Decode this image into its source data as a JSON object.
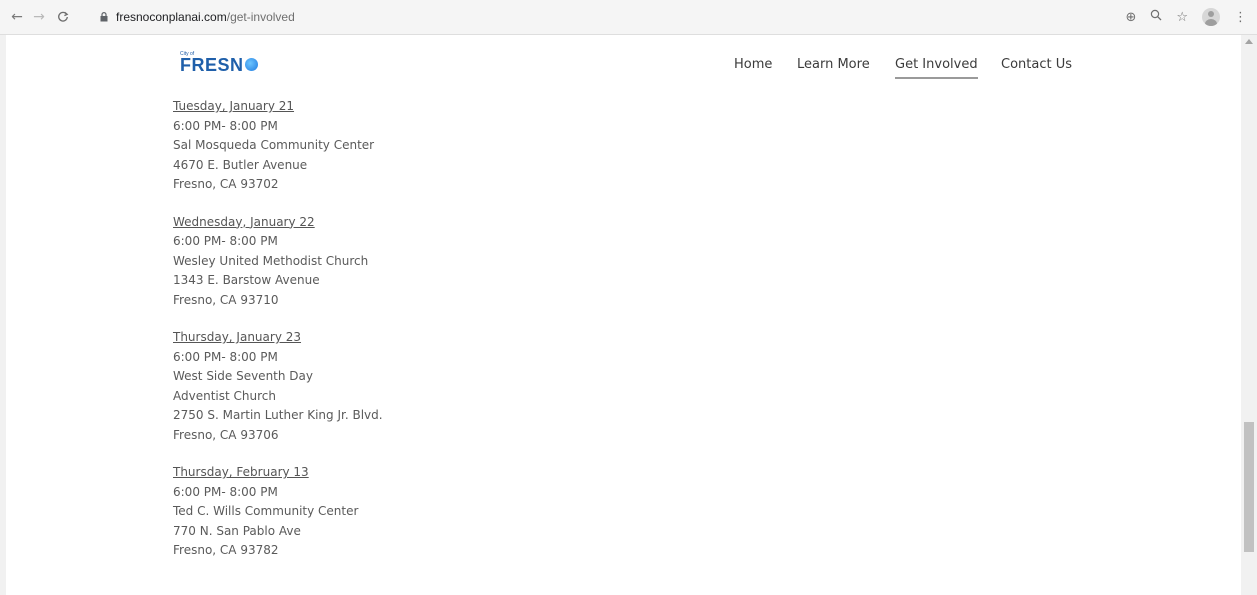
{
  "browser": {
    "url_host": "fresnoconplanai.com",
    "url_path": "/get-involved"
  },
  "site": {
    "logo_small": "City of",
    "logo_text": "FRESN",
    "nav": [
      {
        "label": "Home"
      },
      {
        "label": "Learn More"
      },
      {
        "label": "Get Involved"
      },
      {
        "label": "Contact Us"
      }
    ]
  },
  "events": [
    {
      "date": "Tuesday, January 21",
      "time": "6:00 PM- 8:00 PM",
      "lines": [
        "Sal Mosqueda Community Center",
        "4670 E. Butler Avenue",
        "Fresno, CA 93702"
      ]
    },
    {
      "date": "Wednesday, January 22",
      "time": "6:00 PM- 8:00 PM",
      "lines": [
        "Wesley United Methodist Church",
        "1343 E. Barstow Avenue",
        "Fresno, CA 93710"
      ]
    },
    {
      "date": "Thursday, January 23",
      "time": "6:00 PM- 8:00 PM",
      "lines": [
        "West Side Seventh Day",
        "Adventist Church",
        "2750 S. Martin Luther King Jr. Blvd.",
        "Fresno, CA 93706"
      ]
    },
    {
      "date": "Thursday, February 13",
      "time": "6:00 PM- 8:00 PM",
      "lines": [
        "Ted C. Wills Community Center",
        "770 N. San Pablo Ave",
        "Fresno, CA 93782"
      ]
    }
  ]
}
